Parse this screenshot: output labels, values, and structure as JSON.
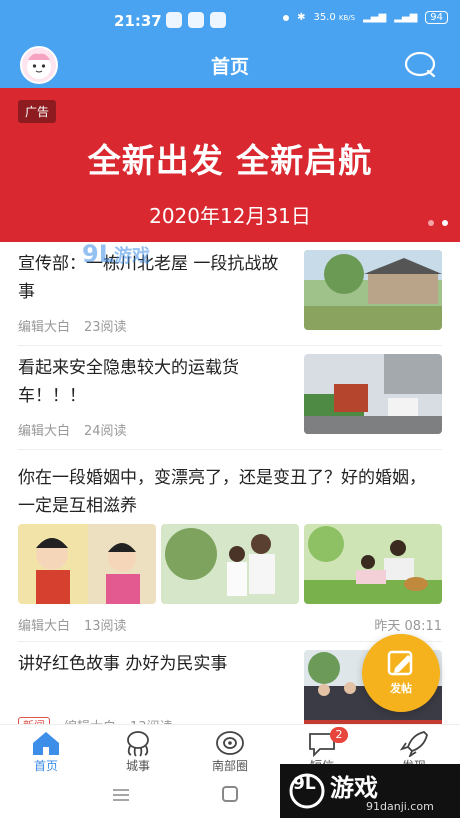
{
  "status_bar": {
    "time": "21:37",
    "network_speed": "35.0",
    "network_unit": "KB/S",
    "battery": "94"
  },
  "header": {
    "title": "首页"
  },
  "banner": {
    "ad_tag": "广告",
    "headline": "全新出发 全新启航",
    "date": "2020年12月31日"
  },
  "feed": {
    "items": [
      {
        "title": "宣传部：一栋川北老屋 一段抗战故事",
        "author": "编辑大白",
        "reads": "23阅读"
      },
      {
        "title": "看起来安全隐患较大的运载货车！！！",
        "author": "编辑大白",
        "reads": "24阅读"
      },
      {
        "title": "你在一段婚姻中，变漂亮了，还是变丑了？好的婚姻，一定是互相滋养",
        "author": "编辑大白",
        "reads": "13阅读",
        "time": "昨天 08:11"
      },
      {
        "title": "讲好红色故事 办好为民实事",
        "tag": "新闻",
        "author": "编辑大白",
        "reads": "13阅读"
      }
    ]
  },
  "post_button": {
    "label": "发帖"
  },
  "tabs": [
    {
      "label": "首页",
      "icon": "home-icon"
    },
    {
      "label": "城事",
      "icon": "octopus-icon"
    },
    {
      "label": "南部圈",
      "icon": "circle-eye-icon"
    },
    {
      "label": "短信",
      "icon": "message-icon",
      "badge": "2"
    },
    {
      "label": "发现",
      "icon": "rocket-icon"
    }
  ],
  "watermark": {
    "brand_mark": "9L",
    "brand_text": "游戏",
    "url": "91danji.com",
    "overlay_mark": "9L",
    "overlay_text": "游戏"
  },
  "colors": {
    "primary": "#4aa3f0",
    "banner_red": "#d9282f",
    "accent_orange": "#f6b21c",
    "badge_red": "#e8453c"
  }
}
